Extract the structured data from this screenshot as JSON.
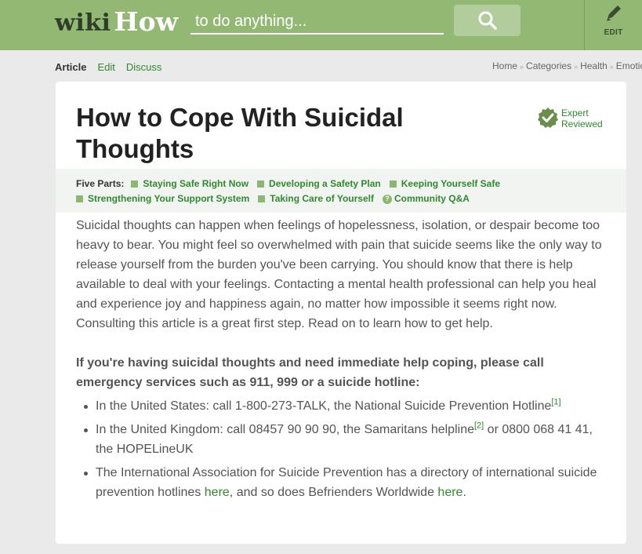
{
  "header": {
    "logo_wiki": "wiki",
    "logo_how": "How",
    "search_placeholder": "to do anything...",
    "search_icon": "search-icon",
    "edit_label": "EDIT",
    "edit_icon": "pencil-icon",
    "colors": {
      "header_bg": "#93b874",
      "search_button_bg": "#b2cc9b",
      "accent": "#2f8a2f"
    }
  },
  "tabs": [
    {
      "label": "Article",
      "active": true
    },
    {
      "label": "Edit",
      "active": false
    },
    {
      "label": "Discuss",
      "active": false
    }
  ],
  "breadcrumb": [
    "Home",
    "Categories",
    "Health",
    "Emotio"
  ],
  "article": {
    "title": "How to Cope With Suicidal Thoughts",
    "expert_line1": "Expert",
    "expert_line2": "Reviewed",
    "parts_label": "Five Parts:",
    "parts": [
      "Staying Safe Right Now",
      "Developing a Safety Plan",
      "Keeping Yourself Safe",
      "Strengthening Your Support System",
      "Taking Care of Yourself",
      "Community Q&A"
    ],
    "intro": "Suicidal thoughts can happen when feelings of hopelessness, isolation, or despair become too heavy to bear. You might feel so overwhelmed with pain that suicide seems like the only way to release yourself from the burden you've been carrying. You should know that there is help available to deal with your feelings. Contacting a mental health professional can help you heal and experience joy and happiness again, no matter how impossible it seems right now. Consulting this article is a great first step. Read on to learn how to get help.",
    "urgent": "If you're having suicidal thoughts and need immediate help coping, please call emergency services such as 911, 999 or a suicide hotline:",
    "bullet1_text": "In the United States: call 1-800-273-TALK, the National Suicide Prevention Hotline",
    "bullet1_ref": "[1]",
    "bullet2_text_a": "In the United Kingdom: call 08457 90 90 90, the Samaritans helpline",
    "bullet2_ref": "[2]",
    "bullet2_text_b": " or 0800 068 41 41, the HOPELineUK",
    "bullet3_text_a": "The International Association for Suicide Prevention has a directory of international suicide prevention hotlines ",
    "bullet3_link1": "here",
    "bullet3_text_b": ", and so does Befrienders Worldwide ",
    "bullet3_link2": "here",
    "bullet3_text_c": "."
  }
}
